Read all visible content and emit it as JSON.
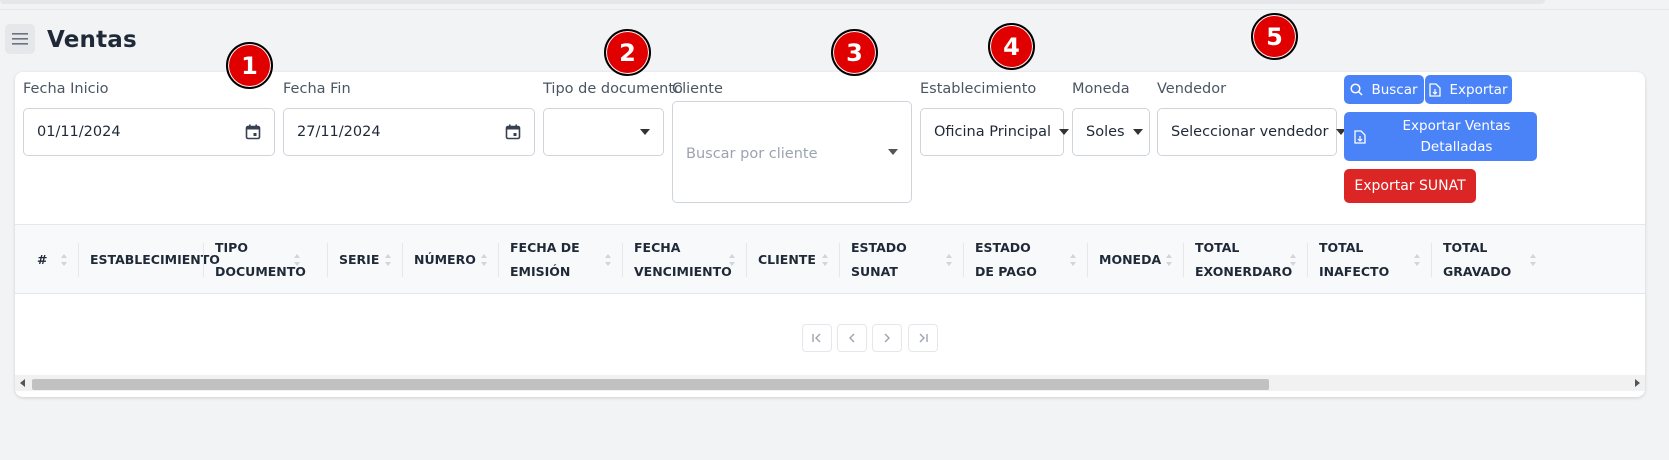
{
  "page": {
    "title": "Ventas"
  },
  "filters": {
    "fecha_inicio": {
      "label": "Fecha Inicio",
      "value": "01/11/2024"
    },
    "fecha_fin": {
      "label": "Fecha Fin",
      "value": "27/11/2024"
    },
    "tipo_documento": {
      "label": "Tipo de documento",
      "value": ""
    },
    "cliente": {
      "label": "Cliente",
      "placeholder": "Buscar por cliente"
    },
    "establecimiento": {
      "label": "Establecimiento",
      "value": "Oficina Principal"
    },
    "moneda": {
      "label": "Moneda",
      "value": "Soles"
    },
    "vendedor": {
      "label": "Vendedor",
      "value": "Seleccionar vendedor"
    }
  },
  "actions": {
    "buscar": "Buscar",
    "exportar": "Exportar",
    "exportar_detalladas": "Exportar Ventas Detalladas",
    "exportar_sunat": "Exportar SUNAT"
  },
  "table": {
    "columns": [
      "#",
      "ESTABLECIMIENTO",
      "TIPO DOCUMENTO",
      "SERIE",
      "NÚMERO",
      "FECHA DE EMISIÓN",
      "FECHA VENCIMIENTO",
      "CLIENTE",
      "ESTADO SUNAT",
      "ESTADO DE PAGO",
      "MONEDA",
      "TOTAL EXONERDARO",
      "TOTAL INAFECTO",
      "TOTAL GRAVADO"
    ],
    "rows": []
  },
  "markers": [
    "1",
    "2",
    "3",
    "4",
    "5"
  ],
  "colors": {
    "primary": "#4a82f7",
    "danger": "#dc2626",
    "marker": "#e00000"
  }
}
